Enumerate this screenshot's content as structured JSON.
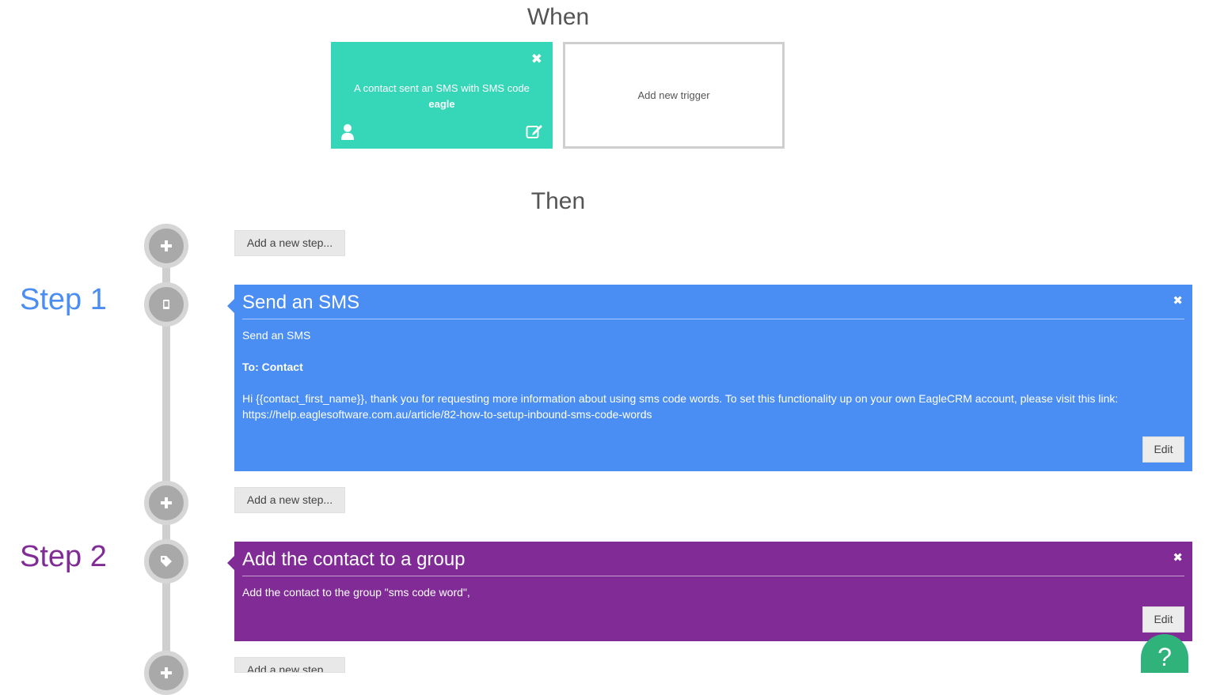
{
  "when": {
    "title": "When"
  },
  "trigger": {
    "text": "A contact sent an SMS with SMS code",
    "code": "eagle",
    "close_label": "✖"
  },
  "add_trigger": {
    "label": "Add new trigger"
  },
  "then": {
    "title": "Then"
  },
  "add_step": {
    "label": "Add a new step..."
  },
  "steps": [
    {
      "label": "Step 1",
      "title": "Send an SMS",
      "close_label": "✖",
      "subtitle": "Send an SMS",
      "to": "To: Contact",
      "message": "Hi {{contact_first_name}}, thank you for requesting more information about using sms code words. To set this functionality up on your own EagleCRM account, please visit this link: https://help.eaglesoftware.com.au/article/82-how-to-setup-inbound-sms-code-words",
      "edit_label": "Edit",
      "icon": "mobile-phone-icon",
      "color": "#4a8df3"
    },
    {
      "label": "Step 2",
      "title": "Add the contact to a group",
      "close_label": "✖",
      "description": "Add the contact to the group \"sms code word\",",
      "edit_label": "Edit",
      "icon": "tag-icon",
      "color": "#812b97"
    }
  ],
  "help": {
    "label": "?",
    "color": "#2fb37b"
  },
  "colors": {
    "trigger": "#36d6b8",
    "timeline": "#cfcfcf",
    "node": "#a9a9a9"
  }
}
